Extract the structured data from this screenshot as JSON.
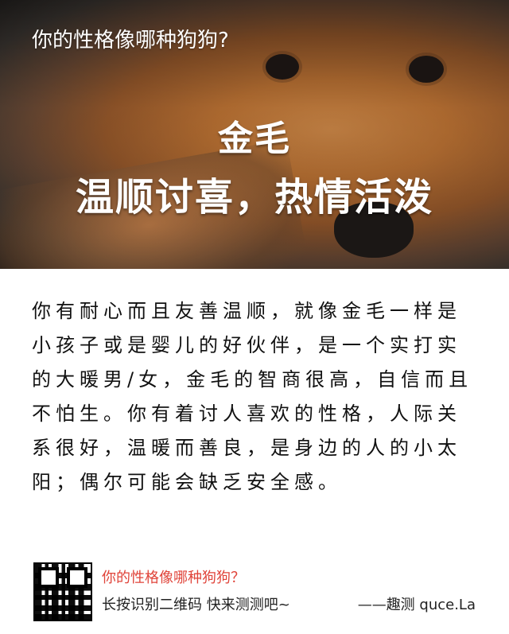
{
  "header": {
    "title": "你的性格像哪种狗狗?"
  },
  "result": {
    "breed": "金毛",
    "tagline": "温顺讨喜，热情活泼",
    "description": "你有耐心而且友善温顺，就像金毛一样是小孩子或是婴儿的好伙伴，是一个实打实的大暖男/女，金毛的智商很高，自信而且不怕生。你有着讨人喜欢的性格，人际关系很好，温暖而善良，是身边的人的小太阳；偶尔可能会缺乏安全感。"
  },
  "footer": {
    "title": "你的性格像哪种狗狗？",
    "hint": "长按识别二维码  快来测测吧~",
    "brand": "——趣测 quce.La"
  },
  "colors": {
    "footer_title": "#e0443a",
    "text": "#111111",
    "hero_text": "#ffffff"
  },
  "icons": {
    "qr": "qr-code-icon"
  }
}
